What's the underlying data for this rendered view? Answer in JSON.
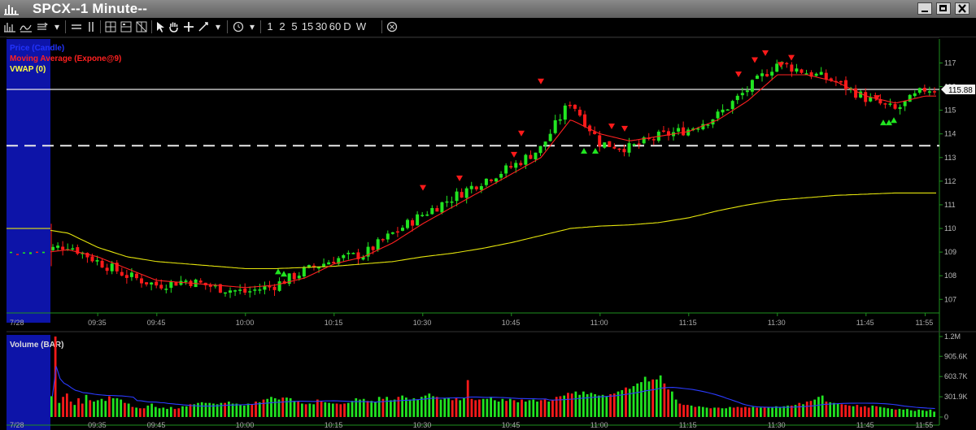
{
  "window": {
    "title": "SPCX--1 Minute--"
  },
  "toolbar": {
    "intervals": [
      "1",
      "2",
      "5",
      "15",
      "30",
      "60",
      "D",
      "W"
    ]
  },
  "colors": {
    "up": "#21e521",
    "down": "#ff1a1a",
    "ema": "#ff2020",
    "vwap": "#e4e40c",
    "volume_ma": "#2b3bff",
    "premarket": "#0d14a8",
    "axis": "#1e8f1e"
  },
  "chart_data": [
    {
      "type": "candlestick",
      "legend": [
        {
          "label": "Price (Candle)",
          "color": "#2233ff"
        },
        {
          "label": "Moving Average (Expone@9)",
          "color": "#ff2020"
        },
        {
          "label": "VWAP (0)",
          "color": "#ffff40"
        }
      ],
      "ylim": [
        106.7,
        117.6
      ],
      "y_ticks": [
        "117",
        "116",
        "115",
        "114",
        "113",
        "112",
        "111",
        "110",
        "109",
        "108",
        "107"
      ],
      "x_ticks": [
        "7/28",
        "09:35",
        "09:45",
        "10:00",
        "10:15",
        "10:30",
        "10:45",
        "11:00",
        "11:15",
        "11:30",
        "11:45",
        "11:55"
      ],
      "last_price": "115.88",
      "horizontal_lines": [
        {
          "value": 115.88,
          "style": "solid"
        },
        {
          "value": 113.5,
          "style": "dashed"
        }
      ],
      "x": [
        "09:25",
        "09:30",
        "09:35",
        "09:40",
        "09:45",
        "09:50",
        "09:55",
        "10:00",
        "10:05",
        "10:10",
        "10:15",
        "10:20",
        "10:25",
        "10:30",
        "10:35",
        "10:40",
        "10:45",
        "10:50",
        "10:55",
        "11:00",
        "11:05",
        "11:10",
        "11:15",
        "11:20",
        "11:25",
        "11:30",
        "11:35",
        "11:40",
        "11:45",
        "11:50",
        "11:55"
      ],
      "close": [
        109.0,
        109.3,
        108.6,
        108.0,
        107.6,
        107.8,
        107.5,
        107.3,
        107.6,
        108.2,
        108.7,
        108.9,
        109.8,
        110.6,
        111.3,
        112.0,
        112.6,
        113.4,
        115.4,
        113.6,
        113.4,
        113.9,
        114.2,
        114.8,
        115.9,
        117.0,
        116.6,
        116.2,
        115.5,
        115.0,
        115.9
      ],
      "ema9": [
        108.95,
        109.1,
        108.8,
        108.3,
        107.8,
        107.7,
        107.6,
        107.5,
        107.6,
        107.9,
        108.5,
        108.8,
        109.4,
        110.2,
        110.9,
        111.6,
        112.3,
        113.0,
        114.6,
        114.0,
        113.7,
        113.9,
        114.1,
        114.6,
        115.4,
        116.5,
        116.5,
        116.2,
        115.6,
        115.3,
        115.6
      ],
      "vwap": [
        110.0,
        109.8,
        109.2,
        108.8,
        108.6,
        108.5,
        108.4,
        108.3,
        108.3,
        108.35,
        108.4,
        108.5,
        108.6,
        108.8,
        108.95,
        109.15,
        109.4,
        109.7,
        110.0,
        110.1,
        110.15,
        110.25,
        110.45,
        110.75,
        111.0,
        111.2,
        111.3,
        111.4,
        111.45,
        111.5,
        111.5
      ]
    },
    {
      "type": "bar",
      "title": "Volume (BAR)",
      "ylim": [
        0,
        1200000
      ],
      "y_ticks": [
        "1.2M",
        "905.6K",
        "603.7K",
        "301.9K",
        "0"
      ],
      "volume": [
        310000,
        1200000,
        210000,
        300000,
        350000,
        230000,
        180000,
        280000,
        200000,
        330000,
        250000,
        230000,
        250000,
        270000,
        240000,
        310000,
        280000,
        280000,
        260000,
        210000,
        200000,
        150000,
        140000,
        130000,
        130000,
        170000,
        200000,
        150000,
        130000,
        140000,
        120000,
        150000,
        120000,
        130000,
        160000,
        160000,
        190000,
        190000,
        210000,
        220000,
        210000,
        210000,
        200000,
        190000,
        210000,
        210000,
        230000,
        200000,
        200000,
        180000,
        170000,
        200000,
        190000,
        230000,
        220000,
        260000,
        270000,
        300000,
        280000,
        260000,
        290000,
        290000,
        280000,
        240000,
        230000,
        200000,
        190000,
        200000,
        190000,
        260000,
        240000,
        220000,
        210000,
        200000,
        200000,
        190000,
        200000,
        210000,
        240000,
        280000,
        260000,
        270000,
        240000,
        240000,
        220000,
        300000,
        270000,
        300000,
        250000,
        260000,
        300000,
        320000,
        290000,
        260000,
        280000,
        260000,
        300000,
        320000,
        350000,
        310000,
        300000,
        260000,
        280000,
        290000,
        250000,
        280000,
        250000,
        280000,
        550000,
        270000,
        250000,
        260000,
        270000,
        270000,
        300000,
        250000,
        230000,
        270000,
        240000,
        270000,
        250000,
        220000,
        260000,
        230000,
        250000,
        260000,
        230000,
        250000,
        260000,
        230000,
        250000,
        300000,
        310000,
        320000,
        360000,
        350000,
        380000,
        330000,
        380000,
        340000,
        360000,
        340000,
        320000,
        330000,
        310000,
        340000,
        350000,
        380000,
        400000,
        440000,
        420000,
        460000,
        500000,
        520000,
        600000,
        530000,
        560000,
        560000,
        620000,
        500000,
        410000,
        380000,
        260000,
        200000,
        180000,
        180000,
        170000,
        150000,
        160000,
        150000,
        140000,
        130000,
        140000,
        140000,
        130000,
        130000,
        150000,
        140000,
        150000,
        140000,
        150000,
        140000,
        150000,
        140000,
        140000,
        150000,
        150000,
        150000,
        160000,
        150000,
        160000,
        170000,
        170000,
        180000,
        210000,
        190000,
        230000,
        240000,
        260000,
        300000,
        320000,
        230000,
        220000,
        210000,
        200000,
        190000,
        180000,
        170000,
        160000,
        180000,
        150000,
        160000,
        140000,
        170000,
        160000,
        150000,
        140000,
        130000,
        120000,
        110000,
        120000,
        110000,
        120000,
        100000,
        90000,
        110000,
        100000,
        90000,
        110000,
        80000
      ]
    }
  ]
}
